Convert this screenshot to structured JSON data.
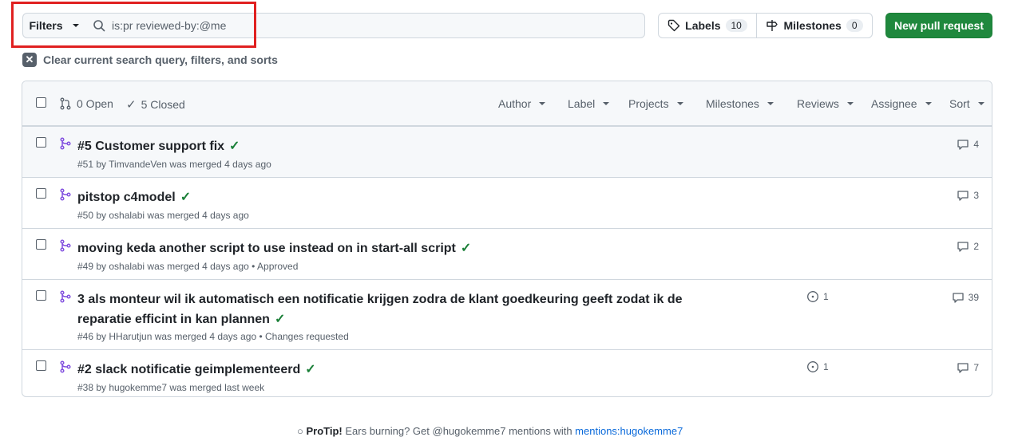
{
  "toolbar": {
    "filters_label": "Filters",
    "search_value": "is:pr reviewed-by:@me",
    "labels_label": "Labels",
    "labels_count": "10",
    "milestones_label": "Milestones",
    "milestones_count": "0",
    "new_pr_label": "New pull request",
    "clear_label": "Clear current search query, filters, and sorts"
  },
  "header": {
    "open_label": "0 Open",
    "closed_label": "5 Closed",
    "filters": [
      "Author",
      "Label",
      "Projects",
      "Milestones",
      "Reviews",
      "Assignee",
      "Sort"
    ]
  },
  "pull_requests": [
    {
      "title": "#5 Customer support fix",
      "meta": "#51 by TimvandeVen was merged 4 days ago",
      "issues": "",
      "comments": "4"
    },
    {
      "title": "pitstop c4model",
      "meta": "#50 by oshalabi was merged 4 days ago",
      "issues": "",
      "comments": "3"
    },
    {
      "title": "moving keda another script to use instead on in start-all script",
      "meta": "#49 by oshalabi was merged 4 days ago • Approved",
      "issues": "",
      "comments": "2"
    },
    {
      "title": "3 als monteur wil ik automatisch een notificatie krijgen zodra de klant goedkeuring geeft zodat ik de reparatie efficint in kan plannen",
      "meta": "#46 by HHarutjun was merged 4 days ago • Changes requested",
      "issues": "1",
      "comments": "39"
    },
    {
      "title": "#2 slack notificatie geimplementeerd",
      "meta": "#38 by hugokemme7 was merged last week",
      "issues": "1",
      "comments": "7"
    }
  ],
  "footer": {
    "protip_label": "ProTip!",
    "protip_text": "Ears burning? Get @hugokemme7 mentions with",
    "protip_link": "mentions:hugokemme7"
  },
  "colors": {
    "accent_green": "#1f883d",
    "merged_purple": "#8250df",
    "highlight_red": "#e02020"
  }
}
